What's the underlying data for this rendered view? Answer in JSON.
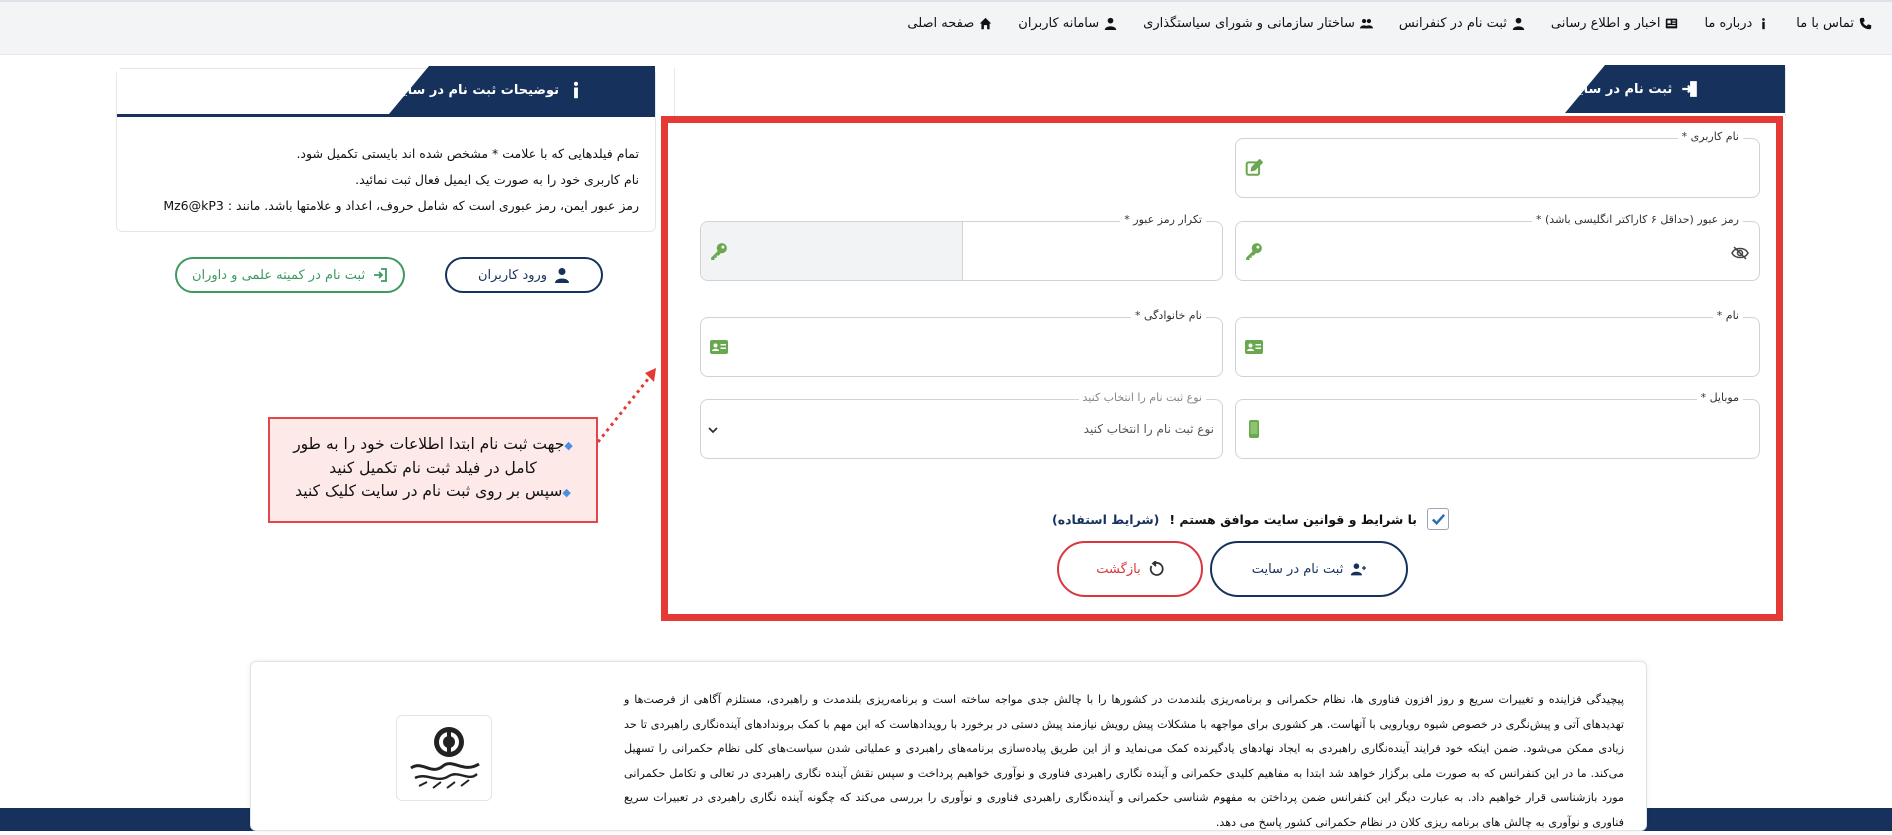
{
  "nav": {
    "items": [
      {
        "label": "صفحه اصلی",
        "icon": "home-icon"
      },
      {
        "label": "سامانه کاربران",
        "icon": "user-icon"
      },
      {
        "label": "ساختار سازمانی و شورای سیاستگذاری",
        "icon": "users-icon"
      },
      {
        "label": "ثبت نام در کنفرانس",
        "icon": "user-icon"
      },
      {
        "label": "اخبار و اطلاع رسانی",
        "icon": "newspaper-icon"
      },
      {
        "label": "درباره ما",
        "icon": "info-icon"
      },
      {
        "label": "تماس با ما",
        "icon": "phone-icon"
      }
    ]
  },
  "help": {
    "title": "توضیحات ثبت نام در سایت",
    "lines": [
      "تمام فیلدهایی که با علامت * مشخص شده اند بایستی تکمیل شود.",
      "نام کاربری خود را به صورت یک ایمیل فعال ثبت نمائید.",
      "رمز عبور ایمن، رمز عبوری است که شامل حروف، اعداد و علامتها باشد. مانند : Mz6@kP3"
    ]
  },
  "side_buttons": {
    "login": "ورود کاربران",
    "committee": "ثبت نام در کمیته علمی و داوران"
  },
  "register": {
    "title": "ثبت نام در سایت",
    "fields": {
      "username": {
        "label": "نام کاربری *",
        "value": ""
      },
      "password": {
        "label": "رمز عبور (حداقل ۶ کاراکتر انگلیسی باشد) *",
        "value": ""
      },
      "password_repeat": {
        "label": "تکرار رمز عبور *",
        "value": ""
      },
      "first_name": {
        "label": "نام *",
        "value": ""
      },
      "last_name": {
        "label": "نام خانوادگی *",
        "value": ""
      },
      "mobile": {
        "label": "موبایل *",
        "value": ""
      },
      "reg_type": {
        "label": "نوع ثبت نام را انتخاب کنید",
        "selected": "نوع ثبت نام را انتخاب کنید"
      }
    },
    "agree_text": "با شرایط و قوانین سایت موافق هستم !",
    "agree_link": "(شرایط استفاده)",
    "agree_checked": true,
    "submit_label": "ثبت نام در سایت",
    "back_label": "بازگشت"
  },
  "callout": {
    "line1": "جهت ثبت نام ابتدا اطلاعات خود را به طور",
    "line2": "کامل در فیلد ثبت نام تکمیل کنید",
    "line3": "سپس بر روی ثبت نام در سایت کلیک کنید"
  },
  "about": {
    "text": "پیچیدگی فزاینده و تغییرات سریع و روز افزون فناوری ها، نظام حکمرانی و برنامه‌ریزی بلندمدت در کشورها را با چالش جدی مواجه ساخته است و برنامه‌ریزی بلندمدت و راهبردی، مستلزم آگاهی از فرصت‌ها و تهدیدهای آتی و پیش‌نگری در خصوص شیوه رویارویی با آنهاست. هر کشوری برای مواجهه با مشکلات پیش رویش نیازمند پیش دستی در برخورد با رویدادهاست که این مهم با کمک برونداد‌های آینده‌نگاری راهبردی تا حد زیادی ممکن می‌شود. ضمن اینکه خود فرایند آینده‌نگاری راهبردی به ایجاد نهادهای یادگیرنده کمک می‌نماید و از این طریق پیاده‌سازی برنامه‌های راهبردی و عملیاتی شدن سیاست‌های کلی نظام حکمرانی را تسهیل می‌کند. ما در این کنفرانس که به صورت ملی برگزار خواهد شد ابتدا به مفاهیم کلیدی حکمرانی و آینده نگاری راهبردی فناوری و نوآوری خواهیم پرداخت و سپس نقش آینده نگاری راهبردی در تعالی و تکامل حکمرانی مورد بازشناسی قرار خواهیم داد. به عبارت دیگر این کنفرانس ضمن پرداختن به مفهوم شناسی حکمرانی و آینده‌نگاری راهبردی فناوری و نوآوری را بررسی می‌کند که چگونه آینده نگاری راهبردی در تعبیرات سریع فناوری و نوآوری به چالش های برنامه ریزی کلان در نظام حکمرانی کشور پاسخ می دهد.",
    "logo_name": "logo-image"
  },
  "colors": {
    "primary": "#16325c",
    "accent_red": "#e53935",
    "green": "#3c9a5f",
    "icon_green": "#6aa84f"
  }
}
